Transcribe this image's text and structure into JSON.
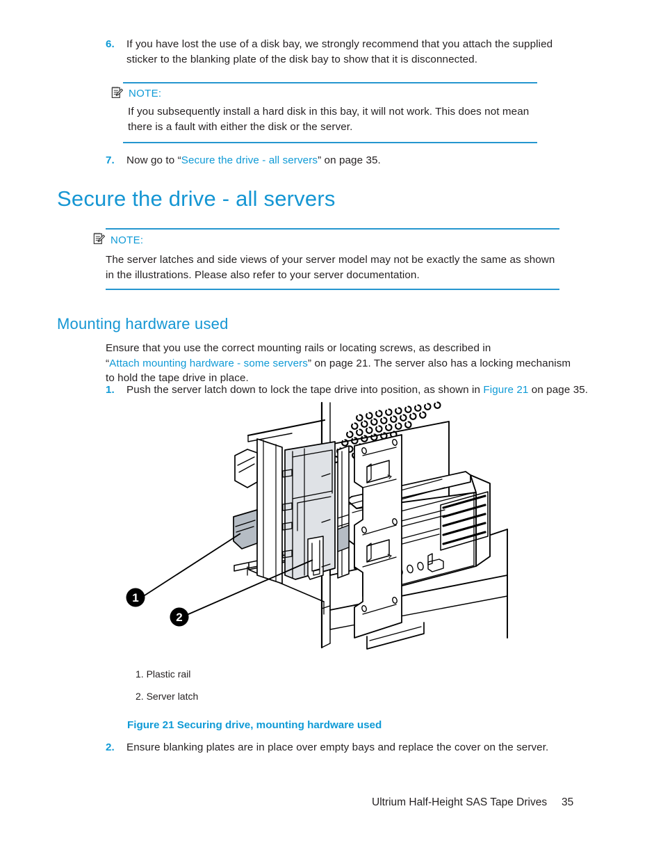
{
  "page": {
    "number": "35",
    "footer_title": "Ultrium Half-Height SAS Tape Drives"
  },
  "colors": {
    "accent_blue": "#0f9ad6",
    "heading_blue": "#1596d3",
    "rule_blue": "#2596cf",
    "body_text": "#231f20"
  },
  "steps_top": {
    "step6": {
      "number": "6.",
      "text": "If you have lost the use of a disk bay, we strongly recommend that you attach the supplied sticker to the blanking plate of the disk bay to show that it is disconnected."
    },
    "step7": {
      "number": "7.",
      "text_before": "Now go to “",
      "link": "Secure the drive - all servers",
      "text_after": "” on page 35."
    }
  },
  "note1": {
    "icon": "note-memo-icon",
    "label": "NOTE:",
    "body": "If you subsequently install a hard disk in this bay, it will not work. This does not mean there is a fault with either the disk or the server."
  },
  "heading": {
    "title": "Secure the drive - all servers"
  },
  "note2": {
    "icon": "note-memo-icon",
    "label": "NOTE:",
    "body": "The server latches and side views of your server model may not be exactly the same as shown in the illustrations. Please also refer to your server documentation."
  },
  "subheading": {
    "title": "Mounting hardware used"
  },
  "mounting": {
    "intro_line1": "Ensure that you use the correct mounting rails or locating screws, as described in",
    "intro_quote_open": "“",
    "intro_link": "Attach mounting hardware - some servers",
    "intro_quote_close": "” on page 21. The server also has a locking mechanism",
    "intro_line3": "to hold the tape drive in place.",
    "step1": {
      "number": "1.",
      "text_before": "Push the server latch down to lock the tape drive into position, as shown in ",
      "link": "Figure 21",
      "text_after": " on page 35."
    },
    "step2": {
      "number": "2.",
      "text": "Ensure blanking plates are in place over empty bays and replace the cover on the server."
    }
  },
  "figure": {
    "callouts": [
      {
        "marker": "1"
      },
      {
        "marker": "2"
      }
    ],
    "legend": [
      "1. Plastic rail",
      "2. Server latch"
    ],
    "caption": "Figure 21 Securing drive, mounting hardware used"
  }
}
